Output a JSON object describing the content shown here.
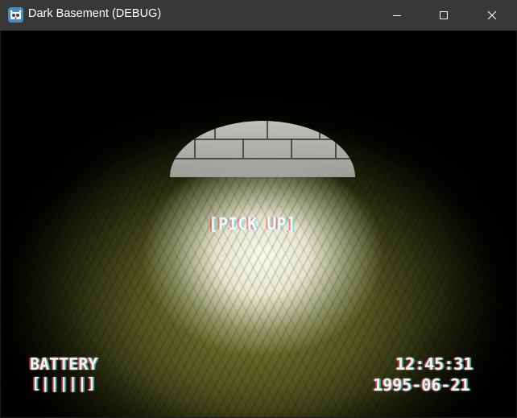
{
  "window": {
    "title": "Dark Basement (DEBUG)",
    "app_icon": "godot-engine-icon",
    "controls": {
      "minimize": "minimize-icon",
      "maximize": "maximize-icon",
      "close": "close-icon"
    }
  },
  "hud": {
    "interaction_prompt": "[PICK UP]",
    "battery_label": "BATTERY",
    "battery_indicator": "[|||||]",
    "time": "12:45:31",
    "date": "1995-06-21"
  },
  "colors": {
    "titlebar": "#383838",
    "title_text": "#ffffff",
    "hud_text": "#f4f4ec",
    "floor_lit": "#f5f5e1",
    "floor_dim": "#5f6426"
  }
}
